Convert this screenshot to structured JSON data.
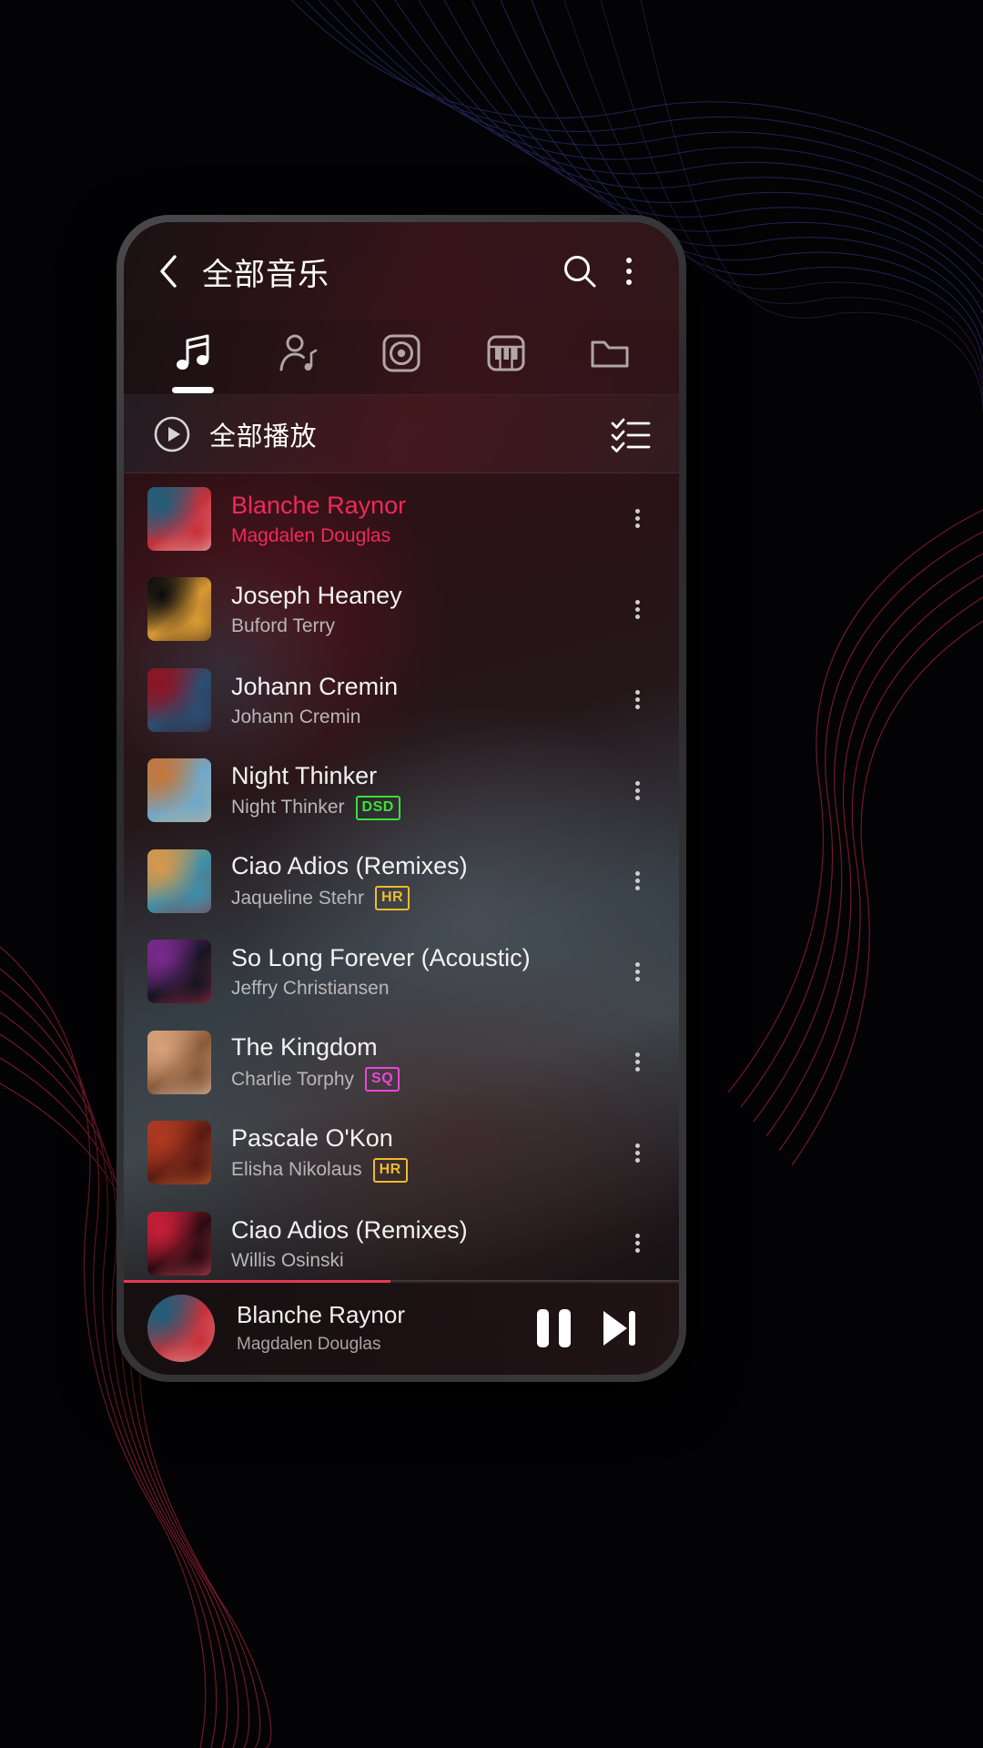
{
  "app": {
    "header": {
      "back_icon": "chevron-left-icon",
      "title": "全部音乐",
      "search_icon": "search-icon",
      "overflow_icon": "more-vertical-icon"
    },
    "tabs": [
      {
        "name": "songs",
        "icon": "music-note-icon",
        "active": true
      },
      {
        "name": "artists",
        "icon": "artist-person-icon",
        "active": false
      },
      {
        "name": "albums",
        "icon": "album-disc-icon",
        "active": false
      },
      {
        "name": "genres",
        "icon": "piano-keys-icon",
        "active": false
      },
      {
        "name": "folders",
        "icon": "folder-icon",
        "active": false
      }
    ],
    "play_all": {
      "label": "全部播放",
      "play_icon": "play-circle-icon",
      "select_icon": "checklist-icon"
    },
    "songs": [
      {
        "title": "Blanche Raynor",
        "artist": "Magdalen Douglas",
        "badge": "",
        "playing": true,
        "art": {
          "c1": "#1d5f7a",
          "c2": "#c8303a",
          "c3": "#e8d0c8"
        }
      },
      {
        "title": "Joseph Heaney",
        "artist": "Buford Terry",
        "badge": "",
        "playing": false,
        "art": {
          "c1": "#0a0a0c",
          "c2": "#d99a34",
          "c3": "#2a1a10"
        }
      },
      {
        "title": "Johann Cremin",
        "artist": "Johann Cremin",
        "badge": "",
        "playing": false,
        "art": {
          "c1": "#8e1322",
          "c2": "#2b4f74",
          "c3": "#3a1420"
        }
      },
      {
        "title": "Night Thinker",
        "artist": "Night Thinker",
        "badge": "DSD",
        "playing": false,
        "art": {
          "c1": "#c4763a",
          "c2": "#6fa8c8",
          "c3": "#d8b88a"
        }
      },
      {
        "title": "Ciao Adios (Remixes)",
        "artist": "Jaqueline Stehr",
        "badge": "HR",
        "playing": false,
        "art": {
          "c1": "#d8984a",
          "c2": "#3f8fa8",
          "c3": "#9c2a30"
        }
      },
      {
        "title": "So Long Forever (Acoustic)",
        "artist": "Jeffry Christiansen",
        "badge": "",
        "playing": false,
        "art": {
          "c1": "#7a2a8e",
          "c2": "#151520",
          "c3": "#c03050"
        }
      },
      {
        "title": "The Kingdom",
        "artist": "Charlie Torphy",
        "badge": "SQ",
        "playing": false,
        "art": {
          "c1": "#d8a27a",
          "c2": "#8a5a3a",
          "c3": "#f0d8c0"
        }
      },
      {
        "title": "Pascale O'Kon",
        "artist": "Elisha Nikolaus",
        "badge": "HR",
        "playing": false,
        "art": {
          "c1": "#b03a22",
          "c2": "#5a1a12",
          "c3": "#e87a3a"
        }
      },
      {
        "title": "Ciao Adios (Remixes)",
        "artist": "Willis Osinski",
        "badge": "",
        "playing": false,
        "art": {
          "c1": "#c81f3a",
          "c2": "#2a0a10",
          "c3": "#f05a70"
        }
      }
    ],
    "now_playing": {
      "title": "Blanche Raynor",
      "artist": "Magdalen Douglas",
      "progress_percent": 48,
      "pause_icon": "pause-icon",
      "next_icon": "skip-next-icon",
      "art": {
        "c1": "#1d5f7a",
        "c2": "#c8303a",
        "c3": "#e8d0c8"
      }
    },
    "colors": {
      "accent": "#ef2a5b",
      "progress": "#e8384f",
      "badge_dsd": "#3ae03a",
      "badge_hr": "#f0bb2a",
      "badge_sq": "#ec45d8"
    }
  }
}
